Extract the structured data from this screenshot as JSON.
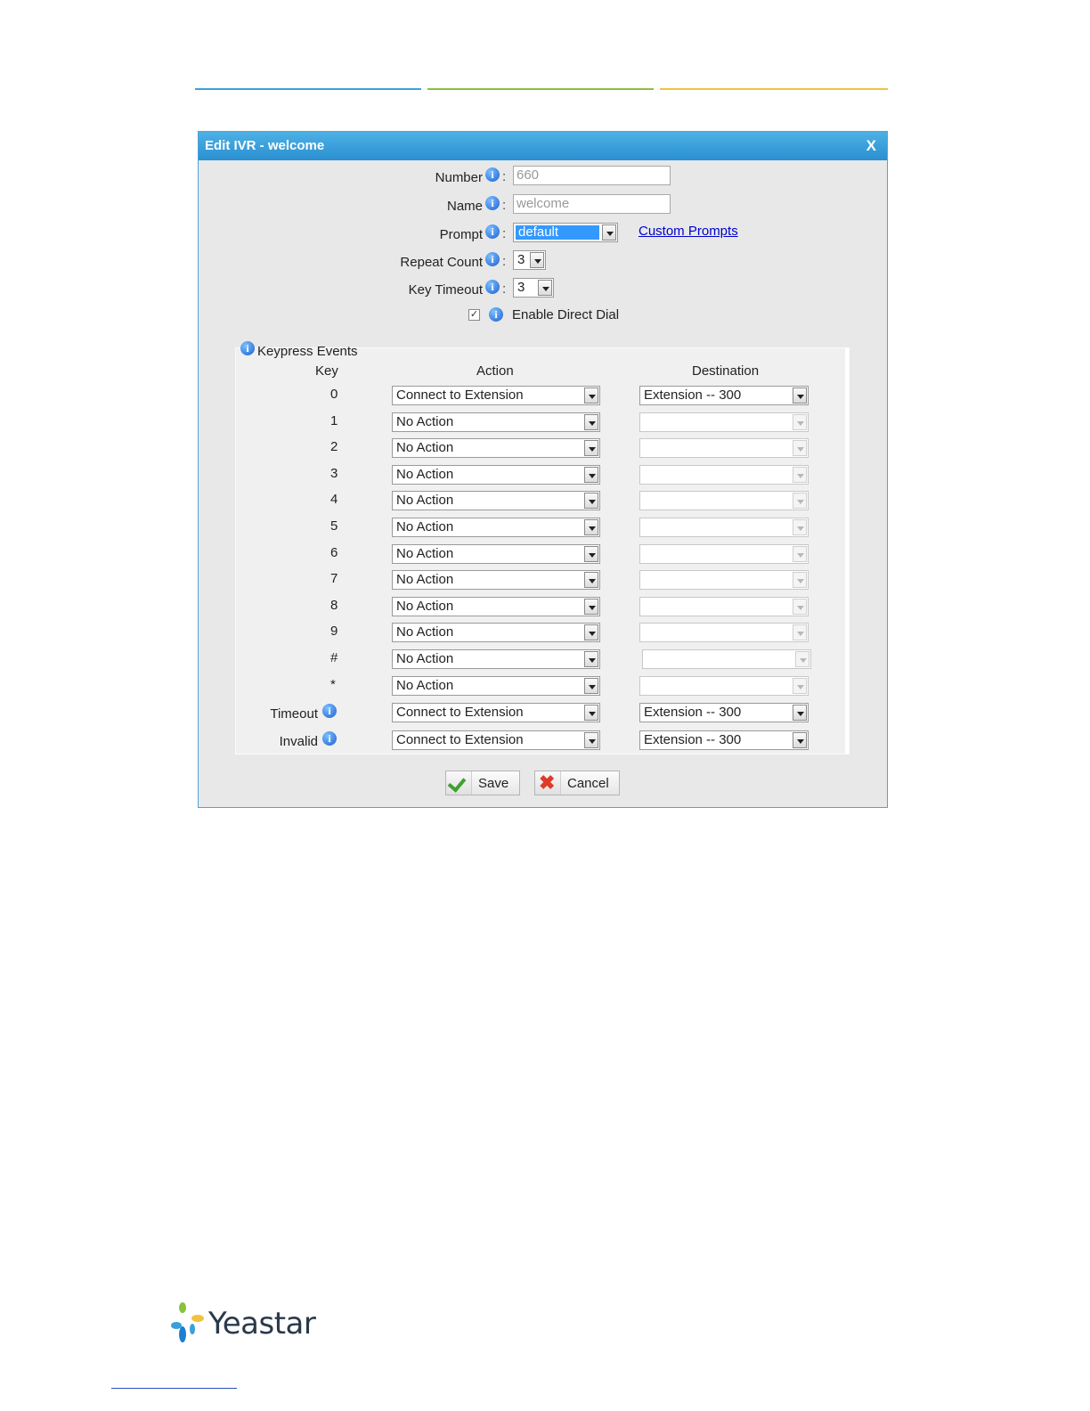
{
  "dialog": {
    "title": "Edit IVR - welcome",
    "close_label": "X",
    "number": {
      "label": "Number",
      "value": "660"
    },
    "name": {
      "label": "Name",
      "value": "welcome"
    },
    "prompt": {
      "label": "Prompt",
      "value": "default",
      "link": "Custom Prompts"
    },
    "repeat_count": {
      "label": "Repeat Count",
      "value": "3"
    },
    "key_timeout": {
      "label": "Key Timeout",
      "value": "3"
    },
    "direct_dial": {
      "label": "Enable Direct Dial",
      "checked": true
    },
    "colon": ":",
    "events": {
      "title": "Keypress Events",
      "headers": {
        "key": "Key",
        "action": "Action",
        "destination": "Destination"
      },
      "rows": [
        {
          "key": "0",
          "action": "Connect to Extension",
          "destination": "Extension -- 300"
        },
        {
          "key": "1",
          "action": "No Action",
          "destination": ""
        },
        {
          "key": "2",
          "action": "No Action",
          "destination": ""
        },
        {
          "key": "3",
          "action": "No Action",
          "destination": ""
        },
        {
          "key": "4",
          "action": "No Action",
          "destination": ""
        },
        {
          "key": "5",
          "action": "No Action",
          "destination": ""
        },
        {
          "key": "6",
          "action": "No Action",
          "destination": ""
        },
        {
          "key": "7",
          "action": "No Action",
          "destination": ""
        },
        {
          "key": "8",
          "action": "No Action",
          "destination": ""
        },
        {
          "key": "9",
          "action": "No Action",
          "destination": ""
        },
        {
          "key": "#",
          "action": "No Action",
          "destination": ""
        },
        {
          "key": "*",
          "action": "No Action",
          "destination": ""
        }
      ],
      "timeout": {
        "label": "Timeout",
        "action": "Connect to Extension",
        "destination": "Extension -- 300"
      },
      "invalid": {
        "label": "Invalid",
        "action": "Connect to Extension",
        "destination": "Extension -- 300"
      }
    },
    "save_label": "Save",
    "cancel_label": "Cancel"
  },
  "footer": {
    "brand": "Yeastar"
  },
  "colors": {
    "title_bar": "#2a8fd0",
    "link": "#0000cc",
    "accent_blue": "#3aa0dc",
    "accent_green": "#8cbf3f",
    "accent_yellow": "#f2c23c"
  }
}
